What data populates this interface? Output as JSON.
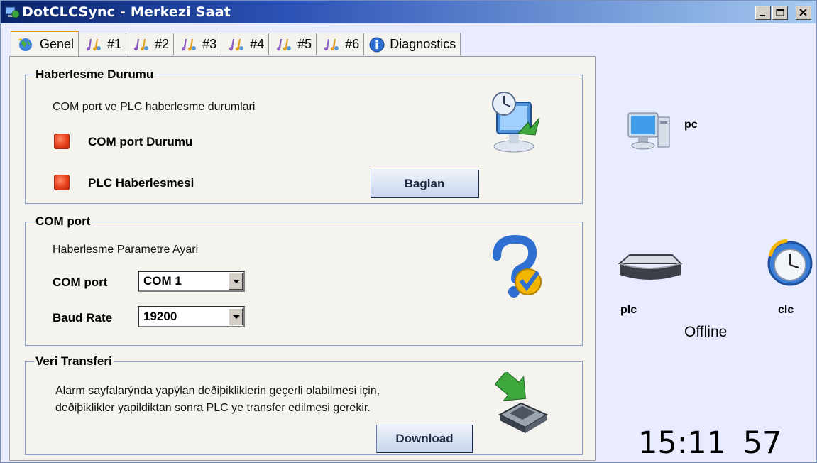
{
  "window": {
    "title": "DotCLCSync - Merkezi Saat",
    "minimize_icon": "minimize-icon",
    "maximize_icon": "maximize-icon",
    "close_icon": "close-icon"
  },
  "tabs": [
    {
      "label": "Genel",
      "icon": "world-icon",
      "active": true
    },
    {
      "label": "#1",
      "icon": "music-note-icon"
    },
    {
      "label": "#2",
      "icon": "music-note-icon"
    },
    {
      "label": "#3",
      "icon": "music-note-icon"
    },
    {
      "label": "#4",
      "icon": "music-note-icon"
    },
    {
      "label": "#5",
      "icon": "music-note-icon"
    },
    {
      "label": "#6",
      "icon": "music-note-icon"
    },
    {
      "label": "Diagnostics",
      "icon": "info-icon"
    }
  ],
  "haberlesme": {
    "title": "Haberlesme Durumu",
    "description": "COM port ve PLC haberlesme durumlari",
    "com_status_label": "COM port Durumu",
    "plc_status_label": "PLC Haberlesmesi",
    "connect_button": "Baglan",
    "status_color": "#e8401c"
  },
  "com_port": {
    "title": "COM port",
    "description": "Haberlesme Parametre Ayari",
    "port_label": "COM port",
    "port_value": "COM 1",
    "baud_label": "Baud Rate",
    "baud_value": "19200"
  },
  "transfer": {
    "title": "Veri Transferi",
    "line1": "Alarm sayfalarýnda yapýlan deðiþikliklerin geçerli olabilmesi için,",
    "line2": "deðiþiklikler yapildiktan sonra PLC ye transfer edilmesi gerekir.",
    "download_button": "Download"
  },
  "network": {
    "pc_label": "pc",
    "plc_label": "plc",
    "clc_label": "clc",
    "status": "Offline"
  },
  "clock": {
    "time": "15:11",
    "seconds": "57"
  }
}
